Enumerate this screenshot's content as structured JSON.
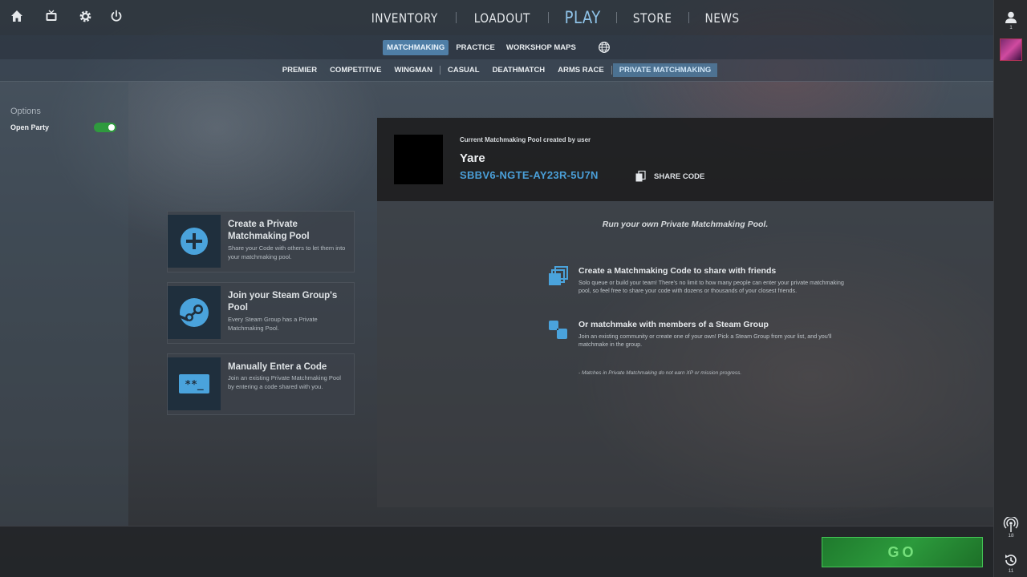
{
  "topbar": {
    "icons": [
      "home-icon",
      "tv-icon",
      "gear-icon",
      "power-icon"
    ],
    "nav": [
      {
        "label": "INVENTORY",
        "active": false
      },
      {
        "label": "LOADOUT",
        "active": false
      },
      {
        "label": "PLAY",
        "active": true
      },
      {
        "label": "STORE",
        "active": false
      },
      {
        "label": "NEWS",
        "active": false
      }
    ]
  },
  "subnav": {
    "tabs": [
      {
        "label": "MATCHMAKING",
        "active": true
      },
      {
        "label": "PRACTICE",
        "active": false
      },
      {
        "label": "WORKSHOP MAPS",
        "active": false
      }
    ],
    "globe_icon": "globe-icon"
  },
  "modes": [
    {
      "label": "PREMIER",
      "active": false
    },
    {
      "label": "COMPETITIVE",
      "active": false
    },
    {
      "label": "WINGMAN",
      "active": false
    },
    {
      "label": "CASUAL",
      "active": false
    },
    {
      "label": "DEATHMATCH",
      "active": false
    },
    {
      "label": "ARMS RACE",
      "active": false
    },
    {
      "label": "PRIVATE MATCHMAKING",
      "active": true
    }
  ],
  "options": {
    "label": "Options",
    "open_party_label": "Open Party",
    "open_party_enabled": true
  },
  "cards": [
    {
      "icon": "plus-circle-icon",
      "title": "Create a Private Matchmaking Pool",
      "desc": "Share your Code with others to let them into your matchmaking pool."
    },
    {
      "icon": "steam-icon",
      "title": "Join your Steam Group's Pool",
      "desc": "Every Steam Group has a Private Matchmaking Pool."
    },
    {
      "icon": "code-entry-icon",
      "title": "Manually Enter a Code",
      "desc": "Join an existing Private Matchmaking Pool by entering a code shared with you."
    }
  ],
  "pool": {
    "caption": "Current Matchmaking Pool created by user",
    "user": "Yare",
    "code": "SBBV6-NGTE-AY23R-5U7N",
    "share_label": "SHARE CODE",
    "headline": "Run your own Private Matchmaking Pool.",
    "info": [
      {
        "icon": "stack-icon",
        "title": "Create a Matchmaking Code to share with friends",
        "text": "Solo queue or build your team! There's no limit to how many people can enter your private matchmaking pool, so feel free to share your code with dozens or thousands of your closest friends."
      },
      {
        "icon": "group-icon",
        "title": "Or matchmake with members of a Steam Group",
        "text": "Join an existing community or create one of your own! Pick a Steam Group from your list, and you'll matchmake in the group."
      }
    ],
    "note": "- Matches in Private Matchmaking do not earn XP or mission progress."
  },
  "go_label": "GO",
  "sidebar": {
    "friends_count": "1",
    "signal_count": "18",
    "history_count": "11"
  },
  "colors": {
    "accent_blue": "#4a9fd8",
    "active_tab": "#4f7ea6",
    "go_green": "#2c9a3c",
    "toggle_green": "#2f9a3e"
  }
}
